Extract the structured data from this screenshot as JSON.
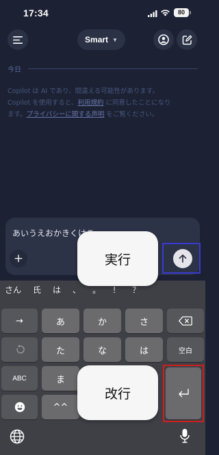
{
  "status": {
    "time": "17:34",
    "battery": "80"
  },
  "header": {
    "model_label": "Smart"
  },
  "chat": {
    "date_label": "今日",
    "disclaimer": {
      "line1": "Copilot は AI であり、間違える可能性があります。",
      "line2_a": "Copilot を使用すると、",
      "terms_link": "利用規約",
      "line2_b": " に同意したことになり",
      "line3_a": "ます。",
      "privacy_link": "プライバシーに関する声明",
      "line3_b": " をご覧ください。"
    }
  },
  "composer": {
    "input_text": "あいうえおかきくけこ"
  },
  "annotations": {
    "execute_label": "実行",
    "newline_label": "改行"
  },
  "keyboard": {
    "candidates": [
      "さん",
      "氏",
      "は",
      "、",
      "。",
      "！",
      "？"
    ],
    "row1": {
      "arrow": "→",
      "k1": "あ",
      "k2": "か",
      "k3": "さ"
    },
    "row2": {
      "k1": "た",
      "k2": "な",
      "k3": "は",
      "space": "空白"
    },
    "row3": {
      "abc": "ABC",
      "k1": "ま"
    },
    "row4": {
      "k1": "^^"
    }
  },
  "colors": {
    "background": "#1c2233",
    "annotation_blue": "#3a3acf",
    "annotation_red": "#d11d1d"
  }
}
